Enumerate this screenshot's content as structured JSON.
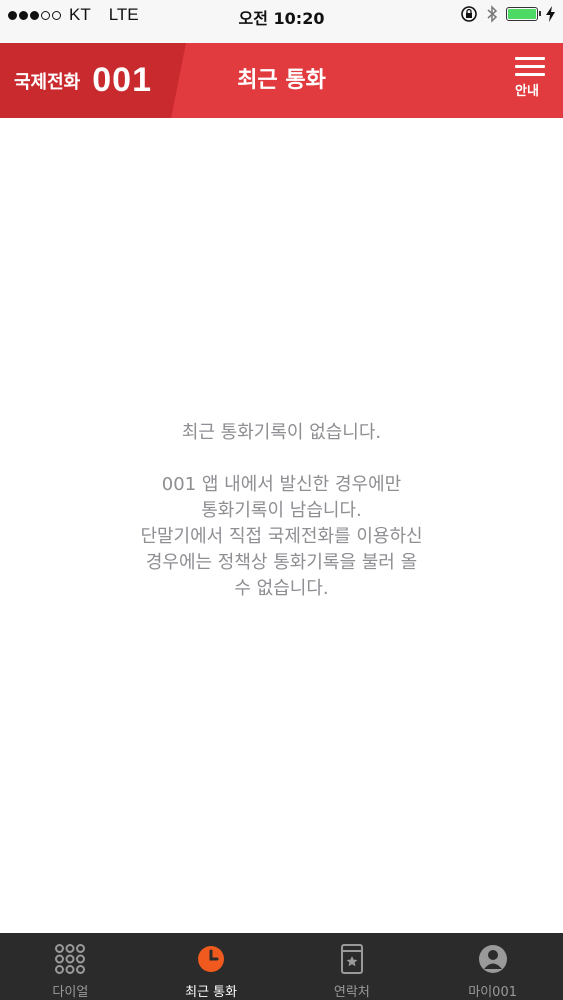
{
  "status_bar": {
    "carrier": "KT",
    "network": "LTE",
    "time": "오전 10:20",
    "battery_level": 1.0
  },
  "header": {
    "brand_text": "국제전화",
    "brand_number": "001",
    "title": "최근 통화",
    "menu_label": "안내"
  },
  "content": {
    "empty_title": "최근 통화기록이 없습니다.",
    "empty_lines": [
      "001 앱 내에서 발신한 경우에만",
      "통화기록이 남습니다.",
      "단말기에서 직접 국제전화를 이용하신",
      "경우에는 정책상 통화기록을 불러 올",
      "수 없습니다."
    ]
  },
  "tabs": [
    {
      "label": "다이얼",
      "icon": "dialpad-icon",
      "active": false
    },
    {
      "label": "최근 통화",
      "icon": "clock-icon",
      "active": true
    },
    {
      "label": "연락처",
      "icon": "contacts-book-icon",
      "active": false
    },
    {
      "label": "마이001",
      "icon": "profile-icon",
      "active": false
    }
  ],
  "colors": {
    "header": "#e23b3f",
    "brand_panel": "#c92a2e",
    "active_icon": "#f05a1e",
    "tabbar": "#2b2b2b"
  }
}
